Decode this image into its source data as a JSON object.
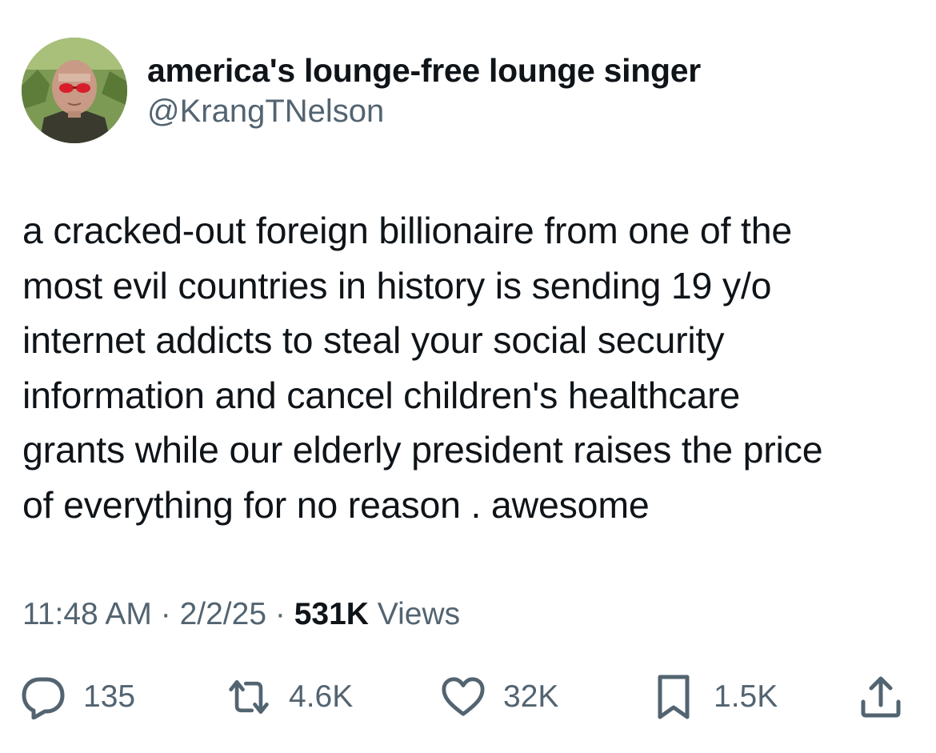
{
  "author": {
    "display_name": "america's lounge-free lounge singer",
    "handle": "@KrangTNelson",
    "avatar_icon": "profile-photo"
  },
  "tweet": {
    "text": "a cracked-out foreign billionaire from one of the\nmost evil countries in history is sending 19 y/o\ninternet addicts to steal your social security\ninformation and cancel children's healthcare\ngrants while our elderly president raises the price\nof everything for no reason . awesome"
  },
  "meta": {
    "time": "11:48 AM",
    "separator": "·",
    "date": "2/2/25",
    "views_count": "531K",
    "views_label": "Views"
  },
  "actions": {
    "reply": {
      "icon": "reply-icon",
      "count": "135"
    },
    "retweet": {
      "icon": "retweet-icon",
      "count": "4.6K"
    },
    "like": {
      "icon": "heart-icon",
      "count": "32K"
    },
    "bookmark": {
      "icon": "bookmark-icon",
      "count": "1.5K"
    },
    "share": {
      "icon": "share-icon"
    }
  },
  "colors": {
    "text_primary": "#0f1419",
    "text_secondary": "#536471",
    "background": "#ffffff"
  }
}
